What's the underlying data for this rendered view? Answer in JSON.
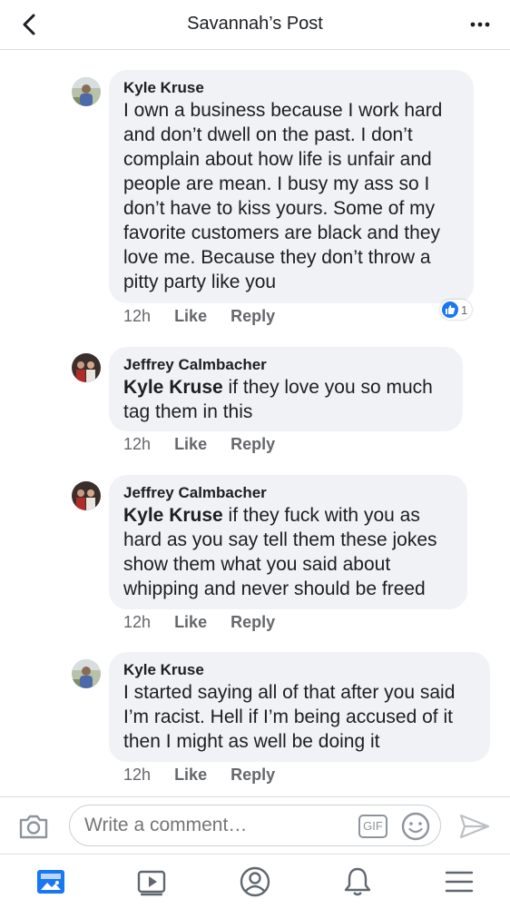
{
  "header": {
    "title": "Savannah’s Post",
    "back_icon": "chevron-left-icon",
    "more_icon": "more-dots-icon"
  },
  "comments": [
    {
      "author": "Kyle Kruse",
      "tag": "",
      "text": "I own a business because I work hard and don’t dwell on the past. I don’t complain about how life is unfair and people are mean. I busy my ass so I don’t have to kiss yours. Some of my favorite customers are black and they love me. Because they don’t throw a pitty party like you",
      "time": "12h",
      "like_label": "Like",
      "reply_label": "Reply",
      "reaction_count": "1"
    },
    {
      "author": "Jeffrey Calmbacher",
      "tag": "Kyle Kruse",
      "text": " if they love you so much tag them in this",
      "time": "12h",
      "like_label": "Like",
      "reply_label": "Reply"
    },
    {
      "author": "Jeffrey Calmbacher",
      "tag": "Kyle Kruse",
      "text": " if they fuck with you as hard as you say tell them these jokes show them what you said about whipping and never should be freed",
      "time": "12h",
      "like_label": "Like",
      "reply_label": "Reply"
    },
    {
      "author": "Kyle Kruse",
      "tag": "",
      "text": "I started saying all of that after you said I’m racist. Hell if I’m being accused of it then I might as well be doing it",
      "time": "12h",
      "like_label": "Like",
      "reply_label": "Reply"
    }
  ],
  "composer": {
    "placeholder": "Write a comment…",
    "gif_label": "GIF"
  },
  "tabs": [
    "news-feed-icon",
    "watch-icon",
    "profile-icon",
    "notifications-bell-icon",
    "menu-icon"
  ],
  "colors": {
    "accent": "#1877f2",
    "bubble": "#f0f2f5",
    "meta": "#65676b"
  }
}
